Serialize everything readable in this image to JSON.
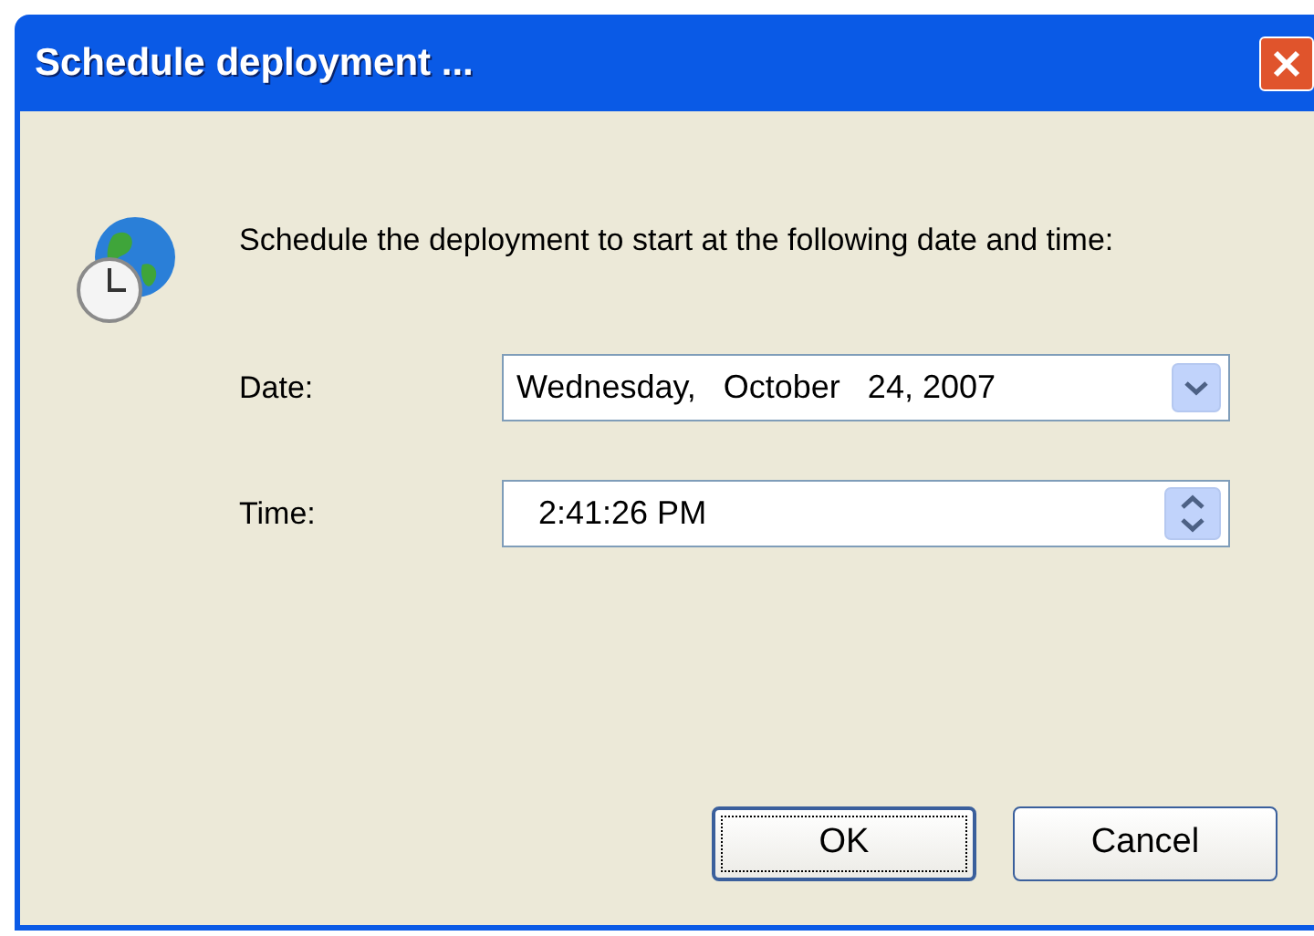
{
  "window": {
    "title": "Schedule deployment ..."
  },
  "message": "Schedule the deployment to start at the following date and time:",
  "fields": [
    {
      "kind": "dropdown",
      "label": "Date:",
      "value": "Wednesday,   October   24, 2007"
    },
    {
      "kind": "spinner",
      "label": "Time:",
      "value": "2:41:26 PM"
    }
  ],
  "buttons": [
    {
      "label": "OK",
      "default": true
    },
    {
      "label": "Cancel",
      "default": false
    }
  ]
}
